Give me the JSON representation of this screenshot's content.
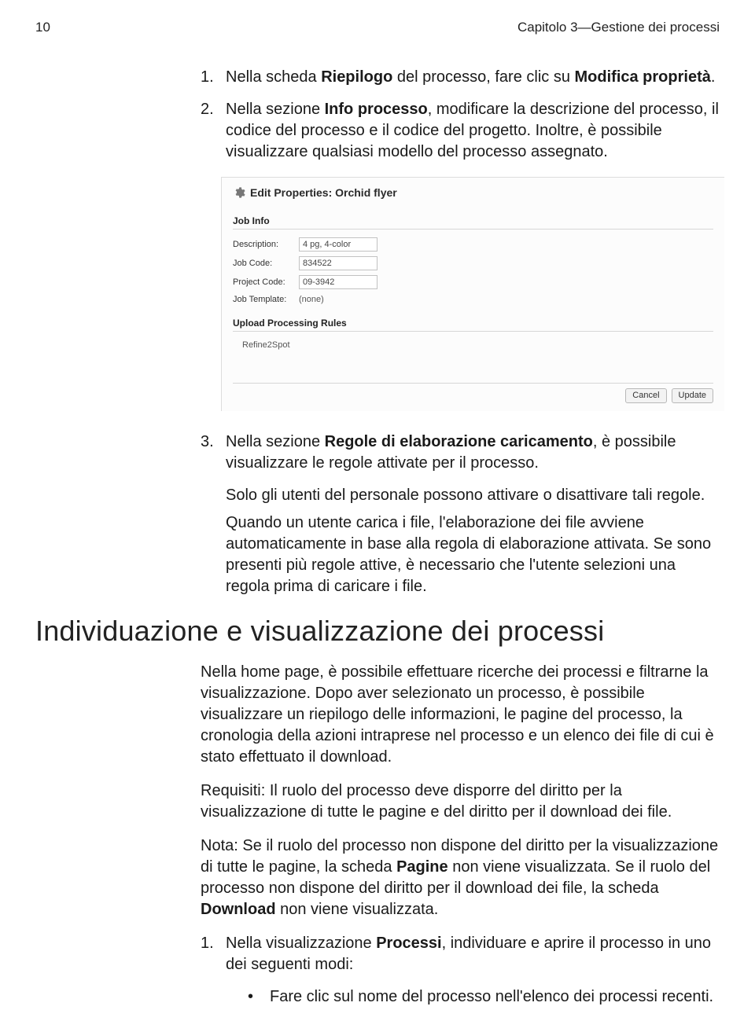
{
  "header": {
    "page_number": "10",
    "chapter": "Capitolo 3—Gestione dei processi"
  },
  "steps": {
    "s1_num": "1.",
    "s1_a": "Nella scheda ",
    "s1_b": "Riepilogo",
    "s1_c": " del processo, fare clic su ",
    "s1_d": "Modifica proprietà",
    "s1_e": ".",
    "s2_num": "2.",
    "s2_a": "Nella sezione ",
    "s2_b": "Info processo",
    "s2_c": ", modificare la descrizione del processo, il codice del processo e il codice del progetto. Inoltre, è possibile visualizzare qualsiasi modello del processo assegnato.",
    "s3_num": "3.",
    "s3_a": "Nella sezione ",
    "s3_b": "Regole di elaborazione caricamento",
    "s3_c": ", è possibile visualizzare le regole attivate per il processo.",
    "s3_sub1": "Solo gli utenti del personale possono attivare o disattivare tali regole.",
    "s3_sub2": "Quando un utente carica i file, l'elaborazione dei file avviene automaticamente in base alla regola di elaborazione attivata. Se sono presenti più regole attive, è necessario che l'utente selezioni una regola prima di caricare i file."
  },
  "screenshot": {
    "title": "Edit Properties: Orchid flyer",
    "section1": "Job Info",
    "desc_label": "Description:",
    "desc_value": "4 pg, 4-color",
    "jobcode_label": "Job Code:",
    "jobcode_value": "834522",
    "projcode_label": "Project Code:",
    "projcode_value": "09-3942",
    "template_label": "Job Template:",
    "template_value": "(none)",
    "section2": "Upload Processing Rules",
    "rule1": "Refine2Spot",
    "cancel": "Cancel",
    "update": "Update"
  },
  "heading": "Individuazione e visualizzazione dei processi",
  "para1": "Nella home page, è possibile effettuare ricerche dei processi e filtrarne la visualizzazione. Dopo aver selezionato un processo, è possibile visualizzare un riepilogo delle informazioni, le pagine del processo, la cronologia della azioni intraprese nel processo e un elenco dei file di cui è stato effettuato il download.",
  "req_label": "Requisiti",
  "req_text": ": Il ruolo del processo deve disporre del diritto per la visualizzazione di tutte le pagine e del diritto per il download dei file.",
  "note_label": "Nota:",
  "note_a": " Se il ruolo del processo non dispone del diritto per la visualizzazione di tutte le pagine, la scheda ",
  "note_b": "Pagine",
  "note_c": " non viene visualizzata. Se il ruolo del processo non dispone del diritto per il download dei file, la scheda ",
  "note_d": "Download",
  "note_e": " non viene visualizzata.",
  "step_b1_num": "1.",
  "step_b1_a": "Nella visualizzazione ",
  "step_b1_b": "Processi",
  "step_b1_c": ", individuare e aprire il processo in uno dei seguenti modi:",
  "bullet1": "Fare clic sul nome del processo nell'elenco dei processi recenti."
}
